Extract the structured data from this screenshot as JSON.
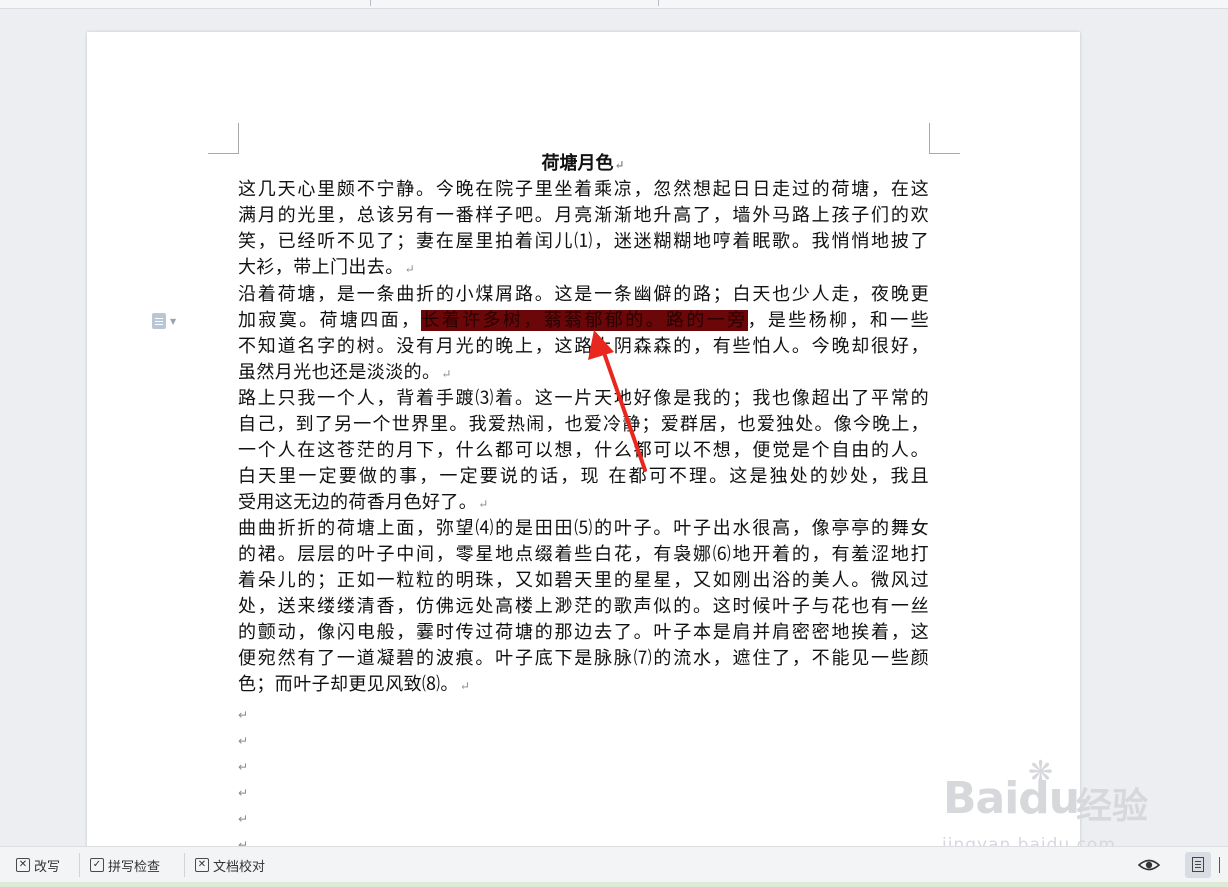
{
  "document": {
    "title": "荷塘月色",
    "paragraphs": [
      {
        "lines": [
          "这几天心里颇不宁静。今晚在院子里坐着乘凉，忽然想起日日走过的荷塘，在这",
          "满月的光里，总该另有一番样子吧。月亮渐渐地升高了，墙外马路上孩子们的欢",
          "笑，已经听不见了；妻在屋里拍着闰儿⑴，迷迷糊糊地哼着眠歌。我悄悄地披了",
          "大衫，带上门出去。"
        ]
      },
      {
        "lines": [
          "沿着荷塘，是一条曲折的小煤屑路。这是一条幽僻的路；白天也少人走，夜晚更",
          "",
          "不知道名字的树。没有月光的晚上，这路上阴森森的，有些怕人。今晚却很好，",
          "虽然月光也还是淡淡的。"
        ],
        "line2_before": "加寂寞。荷塘四面，",
        "line2_highlight": "长着许多树，蓊蓊郁郁的。路的一旁",
        "line2_after": "，是些杨柳，和一些"
      },
      {
        "lines": [
          "路上只我一个人，背着手踱⑶着。这一片天地好像是我的；我也像超出了平常的",
          "自己，到了另一个世界里。我爱热闹，也爱冷静；爱群居，也爱独处。像今晚上，",
          "一个人在这苍茫的月下，什么都可以想，什么都可以不想，便觉是个自由的人。",
          "白天里一定要做的事，一定要说的话，现 在都可不理。这是独处的妙处，我且",
          "受用这无边的荷香月色好了。"
        ]
      },
      {
        "lines": [
          "曲曲折折的荷塘上面，弥望⑷的是田田⑸的叶子。叶子出水很高，像亭亭的舞女",
          "的裙。层层的叶子中间，零星地点缀着些白花，有袅娜⑹地开着的，有羞涩地打",
          "着朵儿的；正如一粒粒的明珠，又如碧天里的星星，又如刚出浴的美人。微风过",
          "处，送来缕缕清香，仿佛远处高楼上渺茫的歌声似的。这时候叶子与花也有一丝",
          "的颤动，像闪电般，霎时传过荷塘的那边去了。叶子本是肩并肩密密地挨着，这",
          "便宛然有了一道凝碧的波痕。叶子底下是脉脉⑺的流水，遮住了，不能见一些颜",
          "色；而叶子却更见风致⑻。"
        ]
      }
    ],
    "paragraph_mark": "↵",
    "empty_marks": [
      "↵",
      "↵",
      "↵",
      "↵",
      "↵",
      "↵"
    ]
  },
  "statusbar": {
    "revise_label": "改写",
    "spellcheck_label": "拼写检查",
    "proofread_label": "文档校对"
  },
  "watermark": {
    "brand": "Baidu",
    "jingyan": "经验",
    "url": "jingyan.baidu.com"
  },
  "colors": {
    "highlight": "#6b0708",
    "arrow": "#e8281e"
  }
}
